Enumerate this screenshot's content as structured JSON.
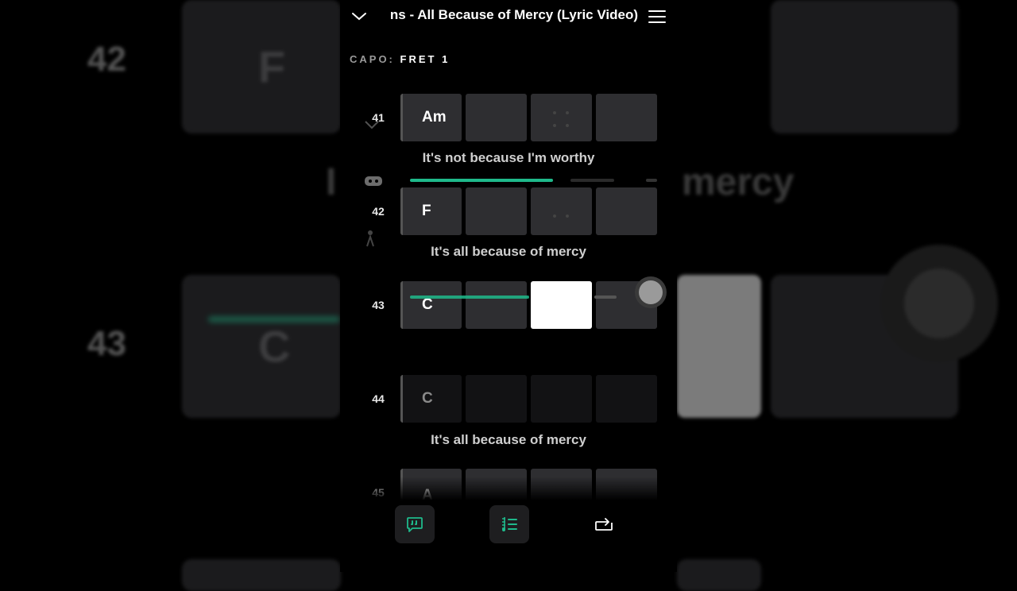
{
  "song": {
    "title": "ns - All Because of Mercy (Lyric Video)"
  },
  "capo": {
    "label": "CAPO:",
    "value": "FRET 1"
  },
  "background": {
    "num_top": "42",
    "num_bottom": "43",
    "chord_top": "F",
    "chord_bottom": "C",
    "lyric_left": "I",
    "lyric_right": "mercy"
  },
  "rows": [
    {
      "num": "41",
      "chord": "Am",
      "lyric": "It's not because I'm worthy"
    },
    {
      "num": "42",
      "chord": "F",
      "lyric": "It's all because of mercy"
    },
    {
      "num": "43",
      "chord": "C",
      "lyric": ""
    },
    {
      "num": "44",
      "chord": "C",
      "lyric": "It's all because of mercy"
    },
    {
      "num": "45",
      "chord": "A",
      "lyric": ""
    }
  ],
  "progress": {
    "fraction": 0.53
  },
  "colors": {
    "accent": "#1fb98b",
    "cell": "#2e2e31",
    "active": "#ffffff"
  },
  "icons": {
    "collapse": "chevron-down-icon",
    "menu": "hamburger-menu-icon",
    "lyrics": "lyrics-quote-icon",
    "chords": "chord-sheet-icon",
    "loop": "loop-icon"
  }
}
